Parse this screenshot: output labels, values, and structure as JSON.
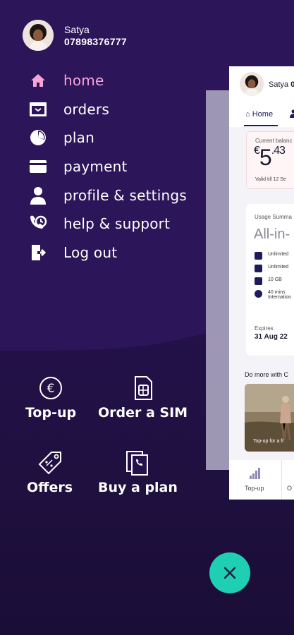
{
  "user": {
    "name": "Satya",
    "number": "07898376777"
  },
  "menu": {
    "items": [
      {
        "label": "home",
        "icon": "home-icon",
        "active": true
      },
      {
        "label": "orders",
        "icon": "orders-icon"
      },
      {
        "label": "plan",
        "icon": "plan-icon"
      },
      {
        "label": "payment",
        "icon": "card-icon"
      },
      {
        "label": "profile & settings",
        "icon": "profile-icon"
      },
      {
        "label": "help & support",
        "icon": "support-icon"
      },
      {
        "label": "Log out",
        "icon": "logout-icon"
      }
    ]
  },
  "quick_actions": {
    "topup": {
      "label": "Top-up",
      "icon": "euro-icon"
    },
    "order_sim": {
      "label": "Order a SIM",
      "icon": "sim-icon"
    },
    "offers": {
      "label": "Offers",
      "icon": "tag-icon"
    },
    "buy_plan": {
      "label": "Buy a plan",
      "icon": "phone-plan-icon"
    }
  },
  "preview": {
    "user_name": "Satya",
    "user_number_partial": "0",
    "tab_home": "Home",
    "balance_label": "Current balanc",
    "balance_value": "5",
    "balance_decimal": ".43",
    "balance_currency": "€",
    "balance_valid": "Valid till 12 Se",
    "usage_label": "Usage Summa",
    "plan_name": "All-in-",
    "features": [
      "Unlimited",
      "Unlimited",
      "10 GB",
      "40 mins",
      "Internation"
    ],
    "expires_label": "Expires",
    "expires_date": "31 Aug 22",
    "do_more": "Do more with C",
    "photo_caption": "Top-up for a fr",
    "nav_topup": "Top-up",
    "nav_second": "O"
  },
  "colors": {
    "background": "#25124d",
    "active": "#f7a4d9",
    "fab": "#1fcfb4",
    "fab_icon": "#1e1b3a"
  },
  "fab": {
    "icon": "close-icon"
  }
}
